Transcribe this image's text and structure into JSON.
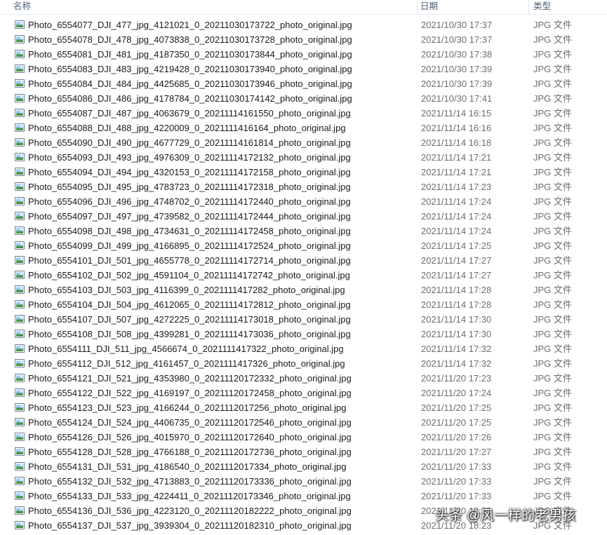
{
  "columns": {
    "name": "名称",
    "date": "日期",
    "type": "类型"
  },
  "files": [
    {
      "name": "Photo_6554077_DJI_477_jpg_4121021_0_20211030173722_photo_original.jpg",
      "date": "2021/10/30 17:37",
      "type": "JPG 文件"
    },
    {
      "name": "Photo_6554078_DJI_478_jpg_4073838_0_20211030173728_photo_original.jpg",
      "date": "2021/10/30 17:37",
      "type": "JPG 文件"
    },
    {
      "name": "Photo_6554081_DJI_481_jpg_4187350_0_20211030173844_photo_original.jpg",
      "date": "2021/10/30 17:38",
      "type": "JPG 文件"
    },
    {
      "name": "Photo_6554083_DJI_483_jpg_4219428_0_20211030173940_photo_original.jpg",
      "date": "2021/10/30 17:39",
      "type": "JPG 文件"
    },
    {
      "name": "Photo_6554084_DJI_484_jpg_4425685_0_20211030173946_photo_original.jpg",
      "date": "2021/10/30 17:39",
      "type": "JPG 文件"
    },
    {
      "name": "Photo_6554086_DJI_486_jpg_4178784_0_20211030174142_photo_original.jpg",
      "date": "2021/10/30 17:41",
      "type": "JPG 文件"
    },
    {
      "name": "Photo_6554087_DJI_487_jpg_4063679_0_20211114161550_photo_original.jpg",
      "date": "2021/11/14 16:15",
      "type": "JPG 文件"
    },
    {
      "name": "Photo_6554088_DJI_488_jpg_4220009_0_2021111416164_photo_original.jpg",
      "date": "2021/11/14 16:16",
      "type": "JPG 文件"
    },
    {
      "name": "Photo_6554090_DJI_490_jpg_4677729_0_20211114161814_photo_original.jpg",
      "date": "2021/11/14 16:18",
      "type": "JPG 文件"
    },
    {
      "name": "Photo_6554093_DJI_493_jpg_4976309_0_20211114172132_photo_original.jpg",
      "date": "2021/11/14 17:21",
      "type": "JPG 文件"
    },
    {
      "name": "Photo_6554094_DJI_494_jpg_4320153_0_20211114172158_photo_original.jpg",
      "date": "2021/11/14 17:21",
      "type": "JPG 文件"
    },
    {
      "name": "Photo_6554095_DJI_495_jpg_4783723_0_20211114172318_photo_original.jpg",
      "date": "2021/11/14 17:23",
      "type": "JPG 文件"
    },
    {
      "name": "Photo_6554096_DJI_496_jpg_4748702_0_20211114172440_photo_original.jpg",
      "date": "2021/11/14 17:24",
      "type": "JPG 文件"
    },
    {
      "name": "Photo_6554097_DJI_497_jpg_4739582_0_20211114172444_photo_original.jpg",
      "date": "2021/11/14 17:24",
      "type": "JPG 文件"
    },
    {
      "name": "Photo_6554098_DJI_498_jpg_4734631_0_20211114172458_photo_original.jpg",
      "date": "2021/11/14 17:24",
      "type": "JPG 文件"
    },
    {
      "name": "Photo_6554099_DJI_499_jpg_4166895_0_20211114172524_photo_original.jpg",
      "date": "2021/11/14 17:25",
      "type": "JPG 文件"
    },
    {
      "name": "Photo_6554101_DJI_501_jpg_4655778_0_20211114172714_photo_original.jpg",
      "date": "2021/11/14 17:27",
      "type": "JPG 文件"
    },
    {
      "name": "Photo_6554102_DJI_502_jpg_4591104_0_20211114172742_photo_original.jpg",
      "date": "2021/11/14 17:27",
      "type": "JPG 文件"
    },
    {
      "name": "Photo_6554103_DJI_503_jpg_4116399_0_2021111417282_photo_original.jpg",
      "date": "2021/11/14 17:28",
      "type": "JPG 文件"
    },
    {
      "name": "Photo_6554104_DJI_504_jpg_4612065_0_20211114172812_photo_original.jpg",
      "date": "2021/11/14 17:28",
      "type": "JPG 文件"
    },
    {
      "name": "Photo_6554107_DJI_507_jpg_4272225_0_20211114173018_photo_original.jpg",
      "date": "2021/11/14 17:30",
      "type": "JPG 文件"
    },
    {
      "name": "Photo_6554108_DJI_508_jpg_4399281_0_20211114173036_photo_original.jpg",
      "date": "2021/11/14 17:30",
      "type": "JPG 文件"
    },
    {
      "name": "Photo_6554111_DJI_511_jpg_4566674_0_2021111417322_photo_original.jpg",
      "date": "2021/11/14 17:32",
      "type": "JPG 文件"
    },
    {
      "name": "Photo_6554112_DJI_512_jpg_4161457_0_2021111417326_photo_original.jpg",
      "date": "2021/11/14 17:32",
      "type": "JPG 文件"
    },
    {
      "name": "Photo_6554121_DJI_521_jpg_4353980_0_20211120172332_photo_original.jpg",
      "date": "2021/11/20 17:23",
      "type": "JPG 文件"
    },
    {
      "name": "Photo_6554122_DJI_522_jpg_4169197_0_20211120172458_photo_original.jpg",
      "date": "2021/11/20 17:24",
      "type": "JPG 文件"
    },
    {
      "name": "Photo_6554123_DJI_523_jpg_4166244_0_2021112017256_photo_original.jpg",
      "date": "2021/11/20 17:25",
      "type": "JPG 文件"
    },
    {
      "name": "Photo_6554124_DJI_524_jpg_4406735_0_20211120172546_photo_original.jpg",
      "date": "2021/11/20 17:25",
      "type": "JPG 文件"
    },
    {
      "name": "Photo_6554126_DJI_526_jpg_4015970_0_20211120172640_photo_original.jpg",
      "date": "2021/11/20 17:26",
      "type": "JPG 文件"
    },
    {
      "name": "Photo_6554128_DJI_528_jpg_4766188_0_20211120172736_photo_original.jpg",
      "date": "2021/11/20 17:27",
      "type": "JPG 文件"
    },
    {
      "name": "Photo_6554131_DJI_531_jpg_4186540_0_2021112017334_photo_original.jpg",
      "date": "2021/11/20 17:33",
      "type": "JPG 文件"
    },
    {
      "name": "Photo_6554132_DJI_532_jpg_4713883_0_20211120173336_photo_original.jpg",
      "date": "2021/11/20 17:33",
      "type": "JPG 文件"
    },
    {
      "name": "Photo_6554133_DJI_533_jpg_4224411_0_20211120173346_photo_original.jpg",
      "date": "2021/11/20 17:33",
      "type": "JPG 文件"
    },
    {
      "name": "Photo_6554136_DJI_536_jpg_4223120_0_20211120182222_photo_original.jpg",
      "date": "2021/11/20 18:22",
      "type": "JPG 文件"
    },
    {
      "name": "Photo_6554137_DJI_537_jpg_3939304_0_20211120182310_photo_original.jpg",
      "date": "2021/11/20 18:23",
      "type": "JPG 文件"
    }
  ],
  "watermark": "头条 @风一样的老男孩",
  "icons": {
    "file": "jpg-file-icon"
  }
}
